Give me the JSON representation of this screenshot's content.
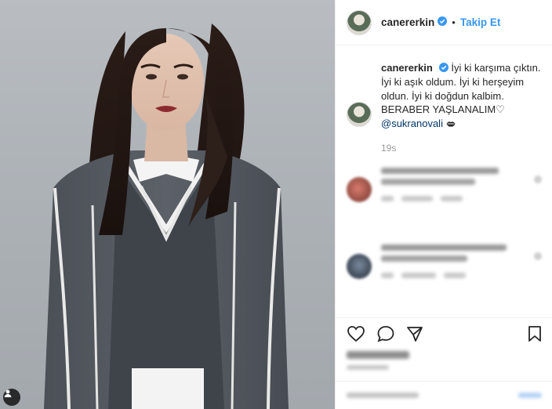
{
  "post": {
    "username": "canererkin",
    "dot": "•",
    "follow_label": "Takip Et"
  },
  "caption": {
    "username": "canererkin",
    "text": "İyi ki karşıma çıktın. İyi ki aşık oldum. İyi ki herşeyim oldun. İyi ki doğdun kalbim. BERABER YAŞLANALIM♡",
    "mention": "@sukranovali",
    "time": "19s"
  },
  "icons": {
    "verified": "verified-badge-icon",
    "like": "heart-icon",
    "comment": "comment-bubble-icon",
    "share": "share-arrow-icon",
    "save": "bookmark-icon",
    "tag": "user-tag-icon"
  },
  "colors": {
    "link_blue": "#3897f0",
    "mention": "#003569",
    "border": "#efefef",
    "muted": "#999999"
  }
}
